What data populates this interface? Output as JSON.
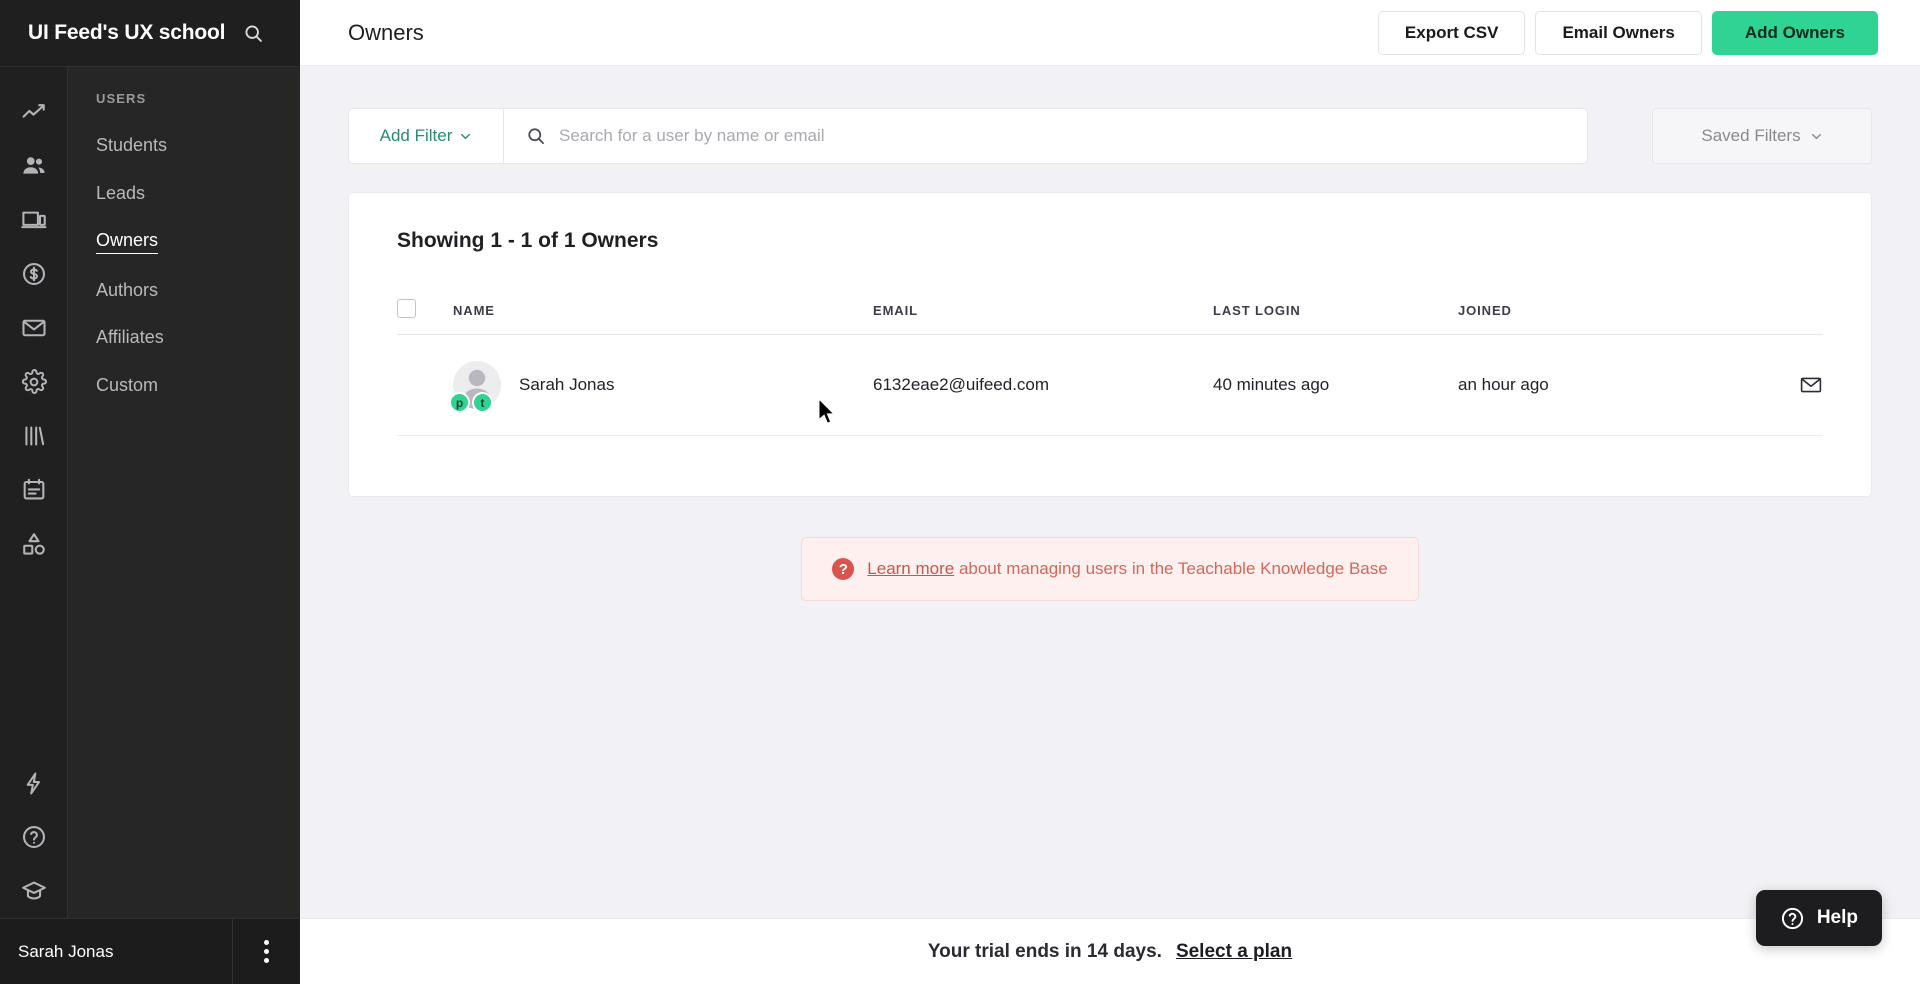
{
  "sidebar": {
    "brand_title": "UI Feed's UX school",
    "search_icon": "search-icon",
    "rail_icons": [
      {
        "name": "analytics-icon"
      },
      {
        "name": "users-icon"
      },
      {
        "name": "site-icon"
      },
      {
        "name": "sales-icon"
      },
      {
        "name": "email-icon"
      },
      {
        "name": "settings-icon"
      },
      {
        "name": "library-icon"
      },
      {
        "name": "pages-icon"
      },
      {
        "name": "shapes-icon"
      }
    ],
    "rail_bottom_icons": [
      {
        "name": "lightning-icon"
      },
      {
        "name": "help-circle-icon"
      },
      {
        "name": "graduation-cap-icon"
      }
    ],
    "section_label": "USERS",
    "items": [
      {
        "label": "Students",
        "active": false
      },
      {
        "label": "Leads",
        "active": false
      },
      {
        "label": "Owners",
        "active": true
      },
      {
        "label": "Authors",
        "active": false
      },
      {
        "label": "Affiliates",
        "active": false
      },
      {
        "label": "Custom",
        "active": false
      }
    ],
    "footer_user": "Sarah Jonas",
    "footer_menu_icon": "kebab-menu-icon"
  },
  "topbar": {
    "title": "Owners",
    "export_csv_label": "Export CSV",
    "email_owners_label": "Email Owners",
    "add_owners_label": "Add Owners",
    "primary_color": "#2fd392"
  },
  "filters": {
    "add_filter_label": "Add Filter",
    "add_filter_color": "#2a8c6a",
    "search_value": "",
    "search_placeholder": "Search for a user by name or email",
    "search_icon": "search-icon",
    "saved_filters_label": "Saved Filters",
    "chevron_icon": "chevron-down-icon"
  },
  "table": {
    "title": "Showing 1 - 1 of 1 Owners",
    "columns": [
      "NAME",
      "EMAIL",
      "LAST LOGIN",
      "JOINED"
    ],
    "rows": [
      {
        "name": "Sarah Jonas",
        "email": "6132eae2@uifeed.com",
        "last_login": "40 minutes ago",
        "joined": "an hour ago",
        "badges": [
          "p",
          "t"
        ],
        "badge_color": "#2fd392",
        "action_icon": "mail-icon",
        "avatar_icon": "avatar-placeholder-icon"
      }
    ]
  },
  "banner": {
    "icon": "question-circle-icon",
    "link_text": "Learn more",
    "text": " about managing users in the Teachable Knowledge Base",
    "bg_color": "#fdf0ee",
    "text_color": "#d3685c"
  },
  "trial": {
    "message": "Your trial ends in 14 days.",
    "link_label": "Select a plan"
  },
  "help": {
    "label": "Help",
    "icon": "question-circle-icon"
  }
}
